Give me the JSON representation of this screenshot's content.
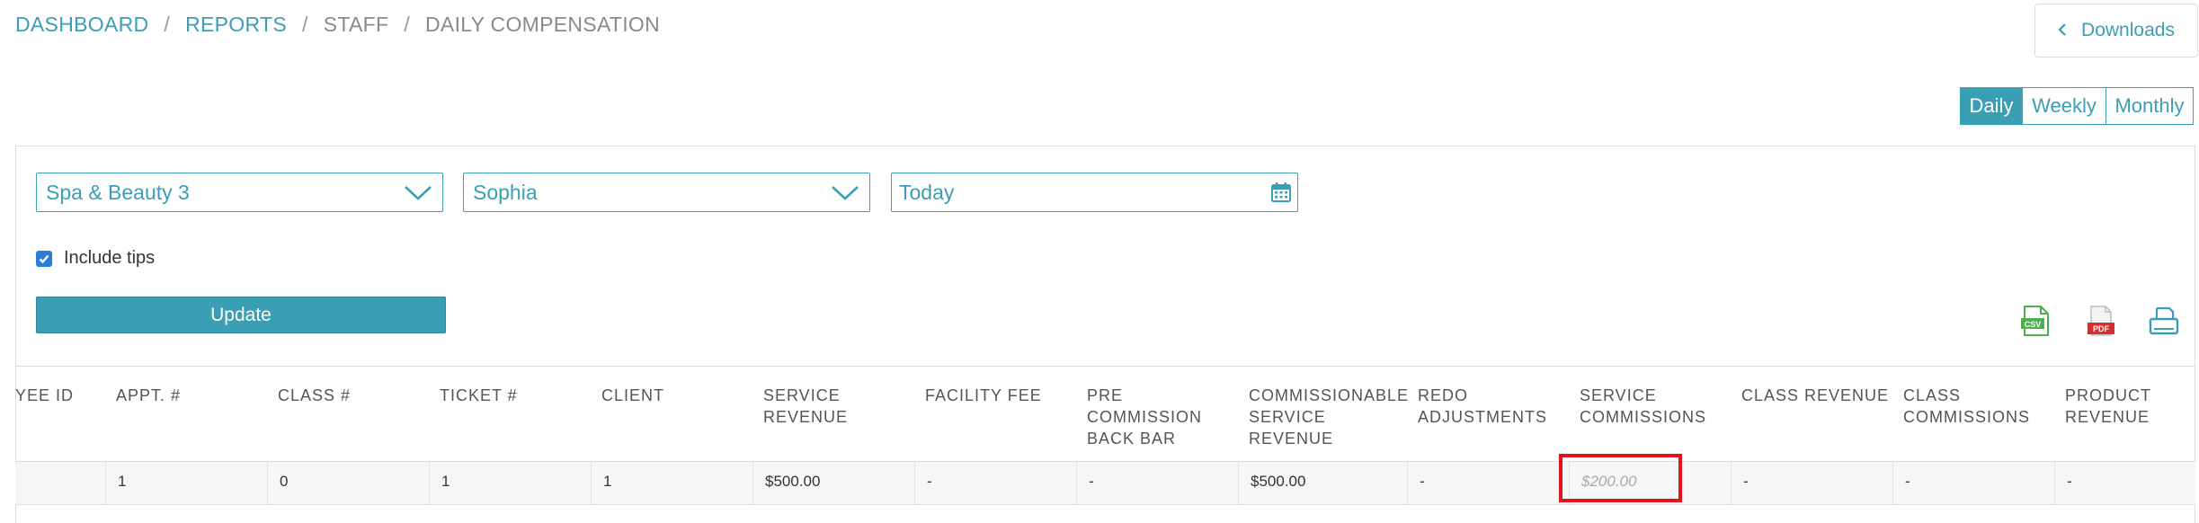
{
  "breadcrumb": {
    "dashboard": "DASHBOARD",
    "reports": "REPORTS",
    "staff": "STAFF",
    "current": "DAILY COMPENSATION",
    "separator": "/"
  },
  "downloads": {
    "label": "Downloads"
  },
  "period": {
    "daily": "Daily",
    "weekly": "Weekly",
    "monthly": "Monthly",
    "selected": "Daily"
  },
  "filters": {
    "location": "Spa & Beauty 3",
    "staff": "Sophia",
    "date": "Today",
    "include_tips_label": "Include tips",
    "include_tips_checked": true,
    "update_label": "Update"
  },
  "export": {
    "csv": "csv-export-icon",
    "pdf": "pdf-export-icon",
    "print": "print-icon"
  },
  "table": {
    "headers": [
      "YEE ID",
      "APPT. #",
      "CLASS #",
      "TICKET #",
      "CLIENT",
      "SERVICE\nREVENUE",
      "FACILITY FEE",
      "PRE\nCOMMISSION\nBACK BAR",
      "COMMISSIONABLE\nSERVICE\nREVENUE",
      "REDO\nADJUSTMENTS",
      "SERVICE\nCOMMISSIONS",
      "CLASS REVENUE",
      "CLASS\nCOMMISSIONS",
      "PRODUCT\nREVENUE"
    ],
    "row": [
      "",
      "1",
      "0",
      "1",
      "1",
      "$500.00",
      "-",
      "-",
      "$500.00",
      "-",
      "$200.00",
      "-",
      "-",
      "-"
    ]
  },
  "colors": {
    "accent": "#3a9fb4",
    "highlight": "#e4141f"
  }
}
